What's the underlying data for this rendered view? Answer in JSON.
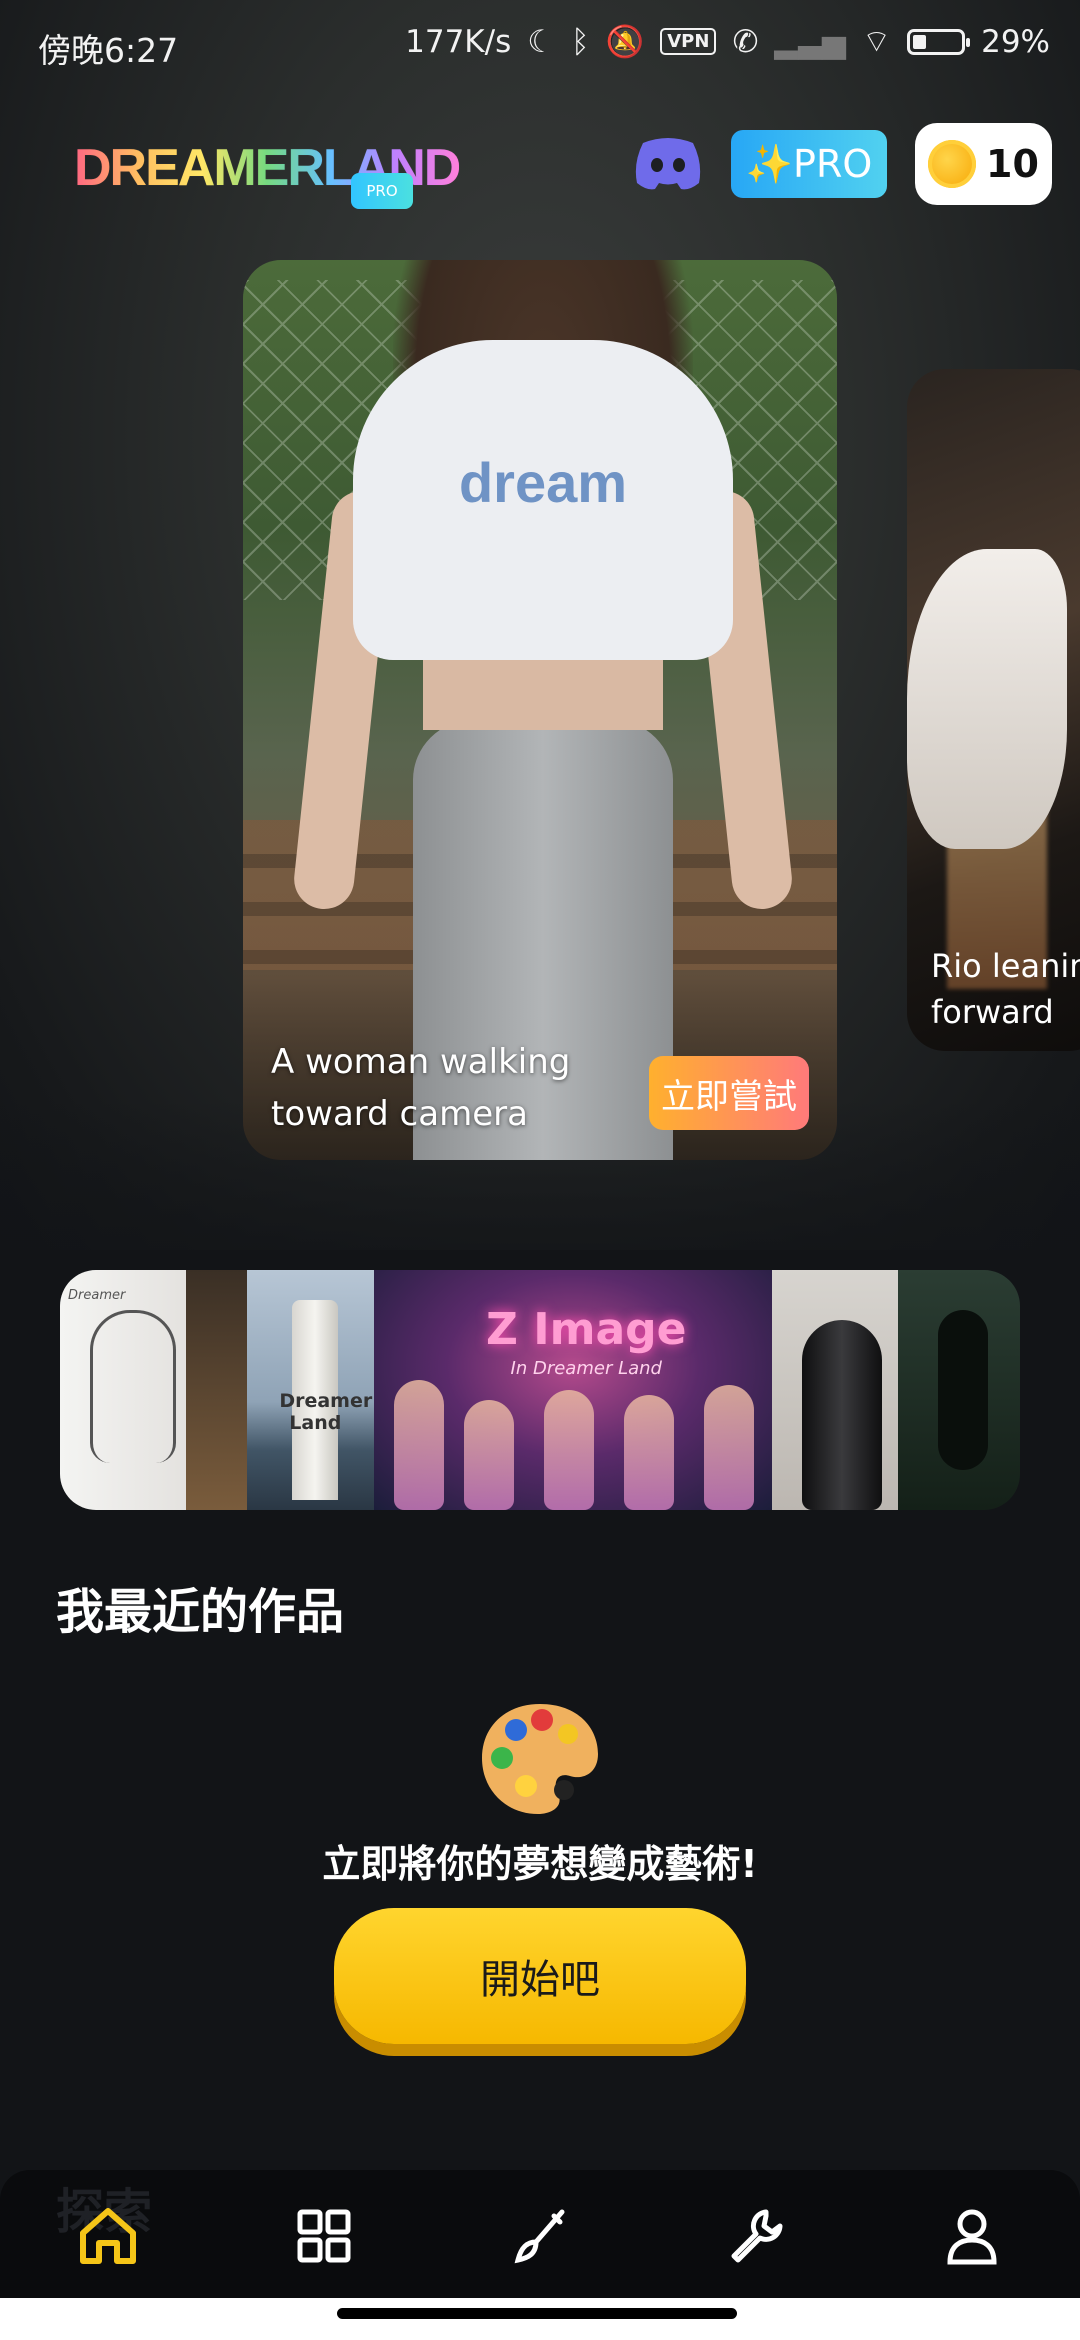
{
  "status_bar": {
    "time": "傍晚6:27",
    "speed": "177K/s",
    "vpn": "VPN",
    "battery_percent": "29%",
    "battery_level": 0.29
  },
  "header": {
    "logo_text": "DREAMERLAND",
    "logo_badge": "PRO",
    "pro_button_label": "✨PRO",
    "coins": "10"
  },
  "featured": [
    {
      "caption": "A woman walking toward camera",
      "shirt_text": "dream",
      "try_label": "立即嘗試"
    },
    {
      "caption": "Rio leanin\nforward"
    }
  ],
  "banner": {
    "title": "Z Image",
    "subtitle": "In Dreamer Land",
    "lighthouse_text": "Dreamer Land",
    "sketch_text": "Dreamer"
  },
  "recent": {
    "section_title": "我最近的作品",
    "empty_text": "立即將你的夢想變成藝術!",
    "start_label": "開始吧"
  },
  "bottom_nav": {
    "ghost_text": "探索",
    "items": [
      {
        "icon": "home-icon",
        "active": true
      },
      {
        "icon": "grid-icon",
        "active": false
      },
      {
        "icon": "brush-icon",
        "active": false
      },
      {
        "icon": "wrench-icon",
        "active": false
      },
      {
        "icon": "user-icon",
        "active": false
      }
    ],
    "active_color": "#f5c518",
    "inactive_color": "#ffffff"
  }
}
